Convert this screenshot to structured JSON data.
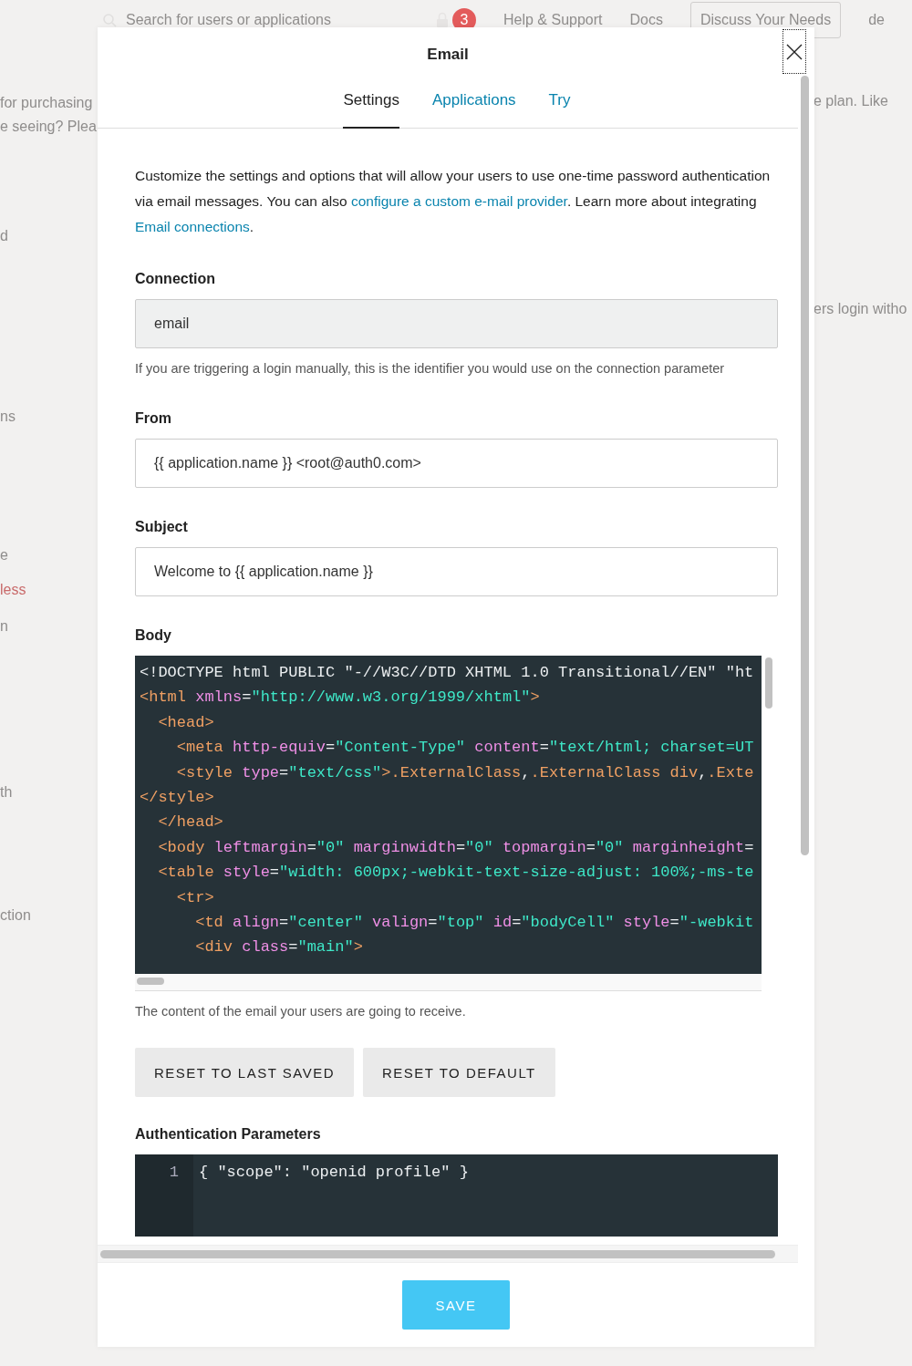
{
  "backdrop": {
    "search": {
      "placeholder": "Search for users or applications"
    },
    "notifications": "3",
    "nav": [
      "Help & Support",
      "Docs"
    ],
    "cta": "Discuss Your Needs",
    "account": "de",
    "left_fragments": [
      "for purchasing",
      "e seeing? Plea",
      "d",
      "ns",
      "e",
      "less",
      "n",
      "th",
      "ction"
    ],
    "right_fragments": [
      "e plan. Like",
      "ers login witho"
    ]
  },
  "dialog": {
    "title": "Email",
    "tabs": [
      {
        "label": "Settings",
        "selected": true
      },
      {
        "label": "Applications",
        "selected": false
      },
      {
        "label": "Try",
        "selected": false
      }
    ],
    "intro": "Customize the settings and options that will allow your users to use one-time password authentication via email messages. You can also ",
    "intro_link": "configure a custom e-mail provider",
    "intro_mid": ". Learn more about integrating ",
    "intro_link2": "Email connections",
    "intro_end": ".",
    "connection": {
      "label": "Connection",
      "value": "email",
      "disabled": true,
      "help": "If you are triggering a login manually, this is the identifier you would use on the connection parameter"
    },
    "from": {
      "label": "From",
      "value": "{{ application.name }} <root@auth0.com>"
    },
    "subject": {
      "label": "Subject",
      "value": "Welcome to {{ application.name }}"
    },
    "body": {
      "label": "Body",
      "help": "The content of the email your users are going to receive.",
      "lines": [
        [
          {
            "kind": "plain",
            "text": "<!DOCTYPE html PUBLIC \"-//W3C//DTD XHTML 1.0 Transitional//EN\" \"ht"
          }
        ],
        [
          {
            "kind": "tag",
            "text": "<html"
          },
          {
            "kind": "attr",
            "text": " xmlns"
          },
          {
            "kind": "plain",
            "text": "="
          },
          {
            "kind": "string",
            "text": "\"http://www.w3.org/1999/xhtml\""
          },
          {
            "kind": "tag",
            "text": ">"
          }
        ],
        [
          {
            "kind": "tag",
            "text": "  <head>"
          }
        ],
        [
          {
            "kind": "tag",
            "text": "    <meta"
          },
          {
            "kind": "attr",
            "text": " http-equiv"
          },
          {
            "kind": "plain",
            "text": "="
          },
          {
            "kind": "string",
            "text": "\"Content-Type\""
          },
          {
            "kind": "attr",
            "text": " content"
          },
          {
            "kind": "plain",
            "text": "="
          },
          {
            "kind": "string",
            "text": "\"text/html; charset=UT"
          }
        ],
        [
          {
            "kind": "tag",
            "text": "    <style"
          },
          {
            "kind": "attr",
            "text": " type"
          },
          {
            "kind": "plain",
            "text": "="
          },
          {
            "kind": "string",
            "text": "\"text/css\""
          },
          {
            "kind": "tag",
            "text": ">.ExternalClass"
          },
          {
            "kind": "plain",
            "text": ","
          },
          {
            "kind": "tag",
            "text": ".ExternalClass div"
          },
          {
            "kind": "plain",
            "text": ","
          },
          {
            "kind": "tag",
            "text": ".Exte"
          }
        ],
        [
          {
            "kind": "tag",
            "text": "</style>"
          }
        ],
        [
          {
            "kind": "tag",
            "text": "  </head>"
          }
        ],
        [
          {
            "kind": "tag",
            "text": "  <body"
          },
          {
            "kind": "attr",
            "text": " leftmargin"
          },
          {
            "kind": "plain",
            "text": "="
          },
          {
            "kind": "string",
            "text": "\"0\""
          },
          {
            "kind": "attr",
            "text": " marginwidth"
          },
          {
            "kind": "plain",
            "text": "="
          },
          {
            "kind": "string",
            "text": "\"0\""
          },
          {
            "kind": "attr",
            "text": " topmargin"
          },
          {
            "kind": "plain",
            "text": "="
          },
          {
            "kind": "string",
            "text": "\"0\""
          },
          {
            "kind": "attr",
            "text": " marginheight"
          },
          {
            "kind": "plain",
            "text": "="
          }
        ],
        [
          {
            "kind": "tag",
            "text": "  <table"
          },
          {
            "kind": "attr",
            "text": " style"
          },
          {
            "kind": "plain",
            "text": "="
          },
          {
            "kind": "string",
            "text": "\"width: 600px;-webkit-text-size-adjust: 100%;-ms-te"
          }
        ],
        [
          {
            "kind": "tag",
            "text": "    <tr>"
          }
        ],
        [
          {
            "kind": "tag",
            "text": "      <td"
          },
          {
            "kind": "attr",
            "text": " align"
          },
          {
            "kind": "plain",
            "text": "="
          },
          {
            "kind": "string",
            "text": "\"center\""
          },
          {
            "kind": "attr",
            "text": " valign"
          },
          {
            "kind": "plain",
            "text": "="
          },
          {
            "kind": "string",
            "text": "\"top\""
          },
          {
            "kind": "attr",
            "text": " id"
          },
          {
            "kind": "plain",
            "text": "="
          },
          {
            "kind": "string",
            "text": "\"bodyCell\""
          },
          {
            "kind": "attr",
            "text": " style"
          },
          {
            "kind": "plain",
            "text": "="
          },
          {
            "kind": "string",
            "text": "\"-webkit"
          }
        ],
        [
          {
            "kind": "tag",
            "text": "      <div"
          },
          {
            "kind": "attr",
            "text": " class"
          },
          {
            "kind": "plain",
            "text": "="
          },
          {
            "kind": "string",
            "text": "\"main\""
          },
          {
            "kind": "tag",
            "text": ">"
          }
        ]
      ]
    },
    "buttons": [
      "RESET TO LAST SAVED",
      "RESET TO DEFAULT"
    ],
    "auth_params": {
      "label": "Authentication Parameters",
      "lines": [
        {
          "number": "1",
          "text": "{ \"scope\": \"openid profile\" }"
        }
      ]
    },
    "save": "SAVE"
  }
}
